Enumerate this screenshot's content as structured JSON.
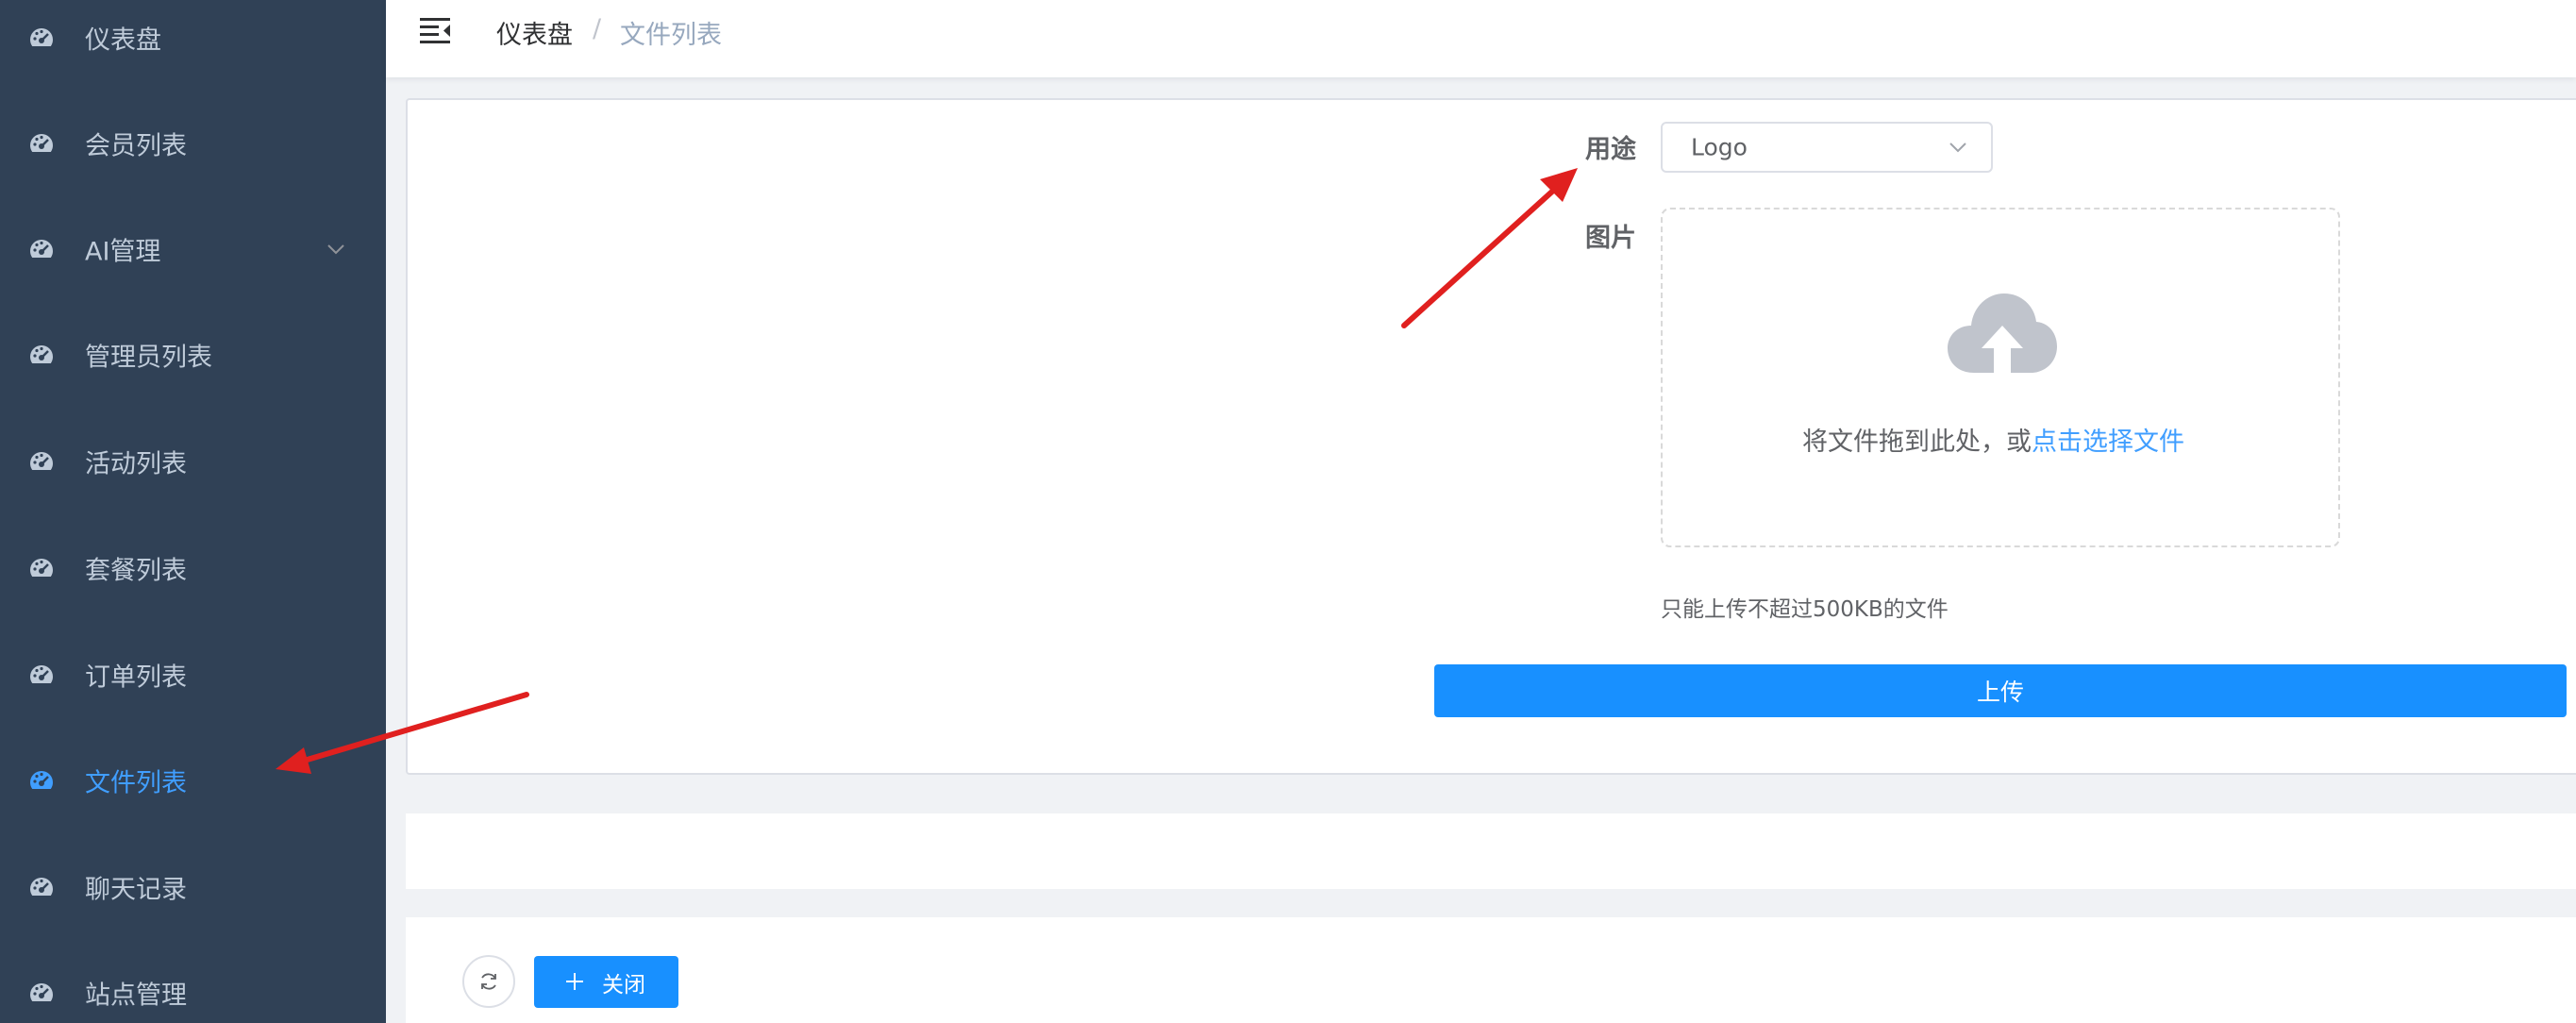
{
  "sidebar": {
    "items": [
      {
        "label": "仪表盘"
      },
      {
        "label": "会员列表"
      },
      {
        "label": "AI管理"
      },
      {
        "label": "管理员列表"
      },
      {
        "label": "活动列表"
      },
      {
        "label": "套餐列表"
      },
      {
        "label": "订单列表"
      },
      {
        "label": "文件列表"
      },
      {
        "label": "聊天记录"
      },
      {
        "label": "站点管理"
      }
    ],
    "active_item": "文件列表",
    "icon": "dashboard-icon",
    "colors": {
      "background": "#304156",
      "text": "#bfcbd9",
      "active": "#409eff"
    }
  },
  "breadcrumb": {
    "home": "仪表盘",
    "separator": "/",
    "current": "文件列表"
  },
  "upload_form": {
    "purpose_label": "用途",
    "purpose_value": "Logo",
    "image_label": "图片",
    "drop_text": "将文件拖到此处，或",
    "drop_link": "点击选择文件",
    "tip": "只能上传不超过500KB的文件",
    "upload_button": "上传"
  },
  "toolbar": {
    "close_button": "关闭"
  },
  "colors": {
    "primary": "#1890ff",
    "link": "#409eff",
    "annotation_arrow": "#e0201f"
  }
}
